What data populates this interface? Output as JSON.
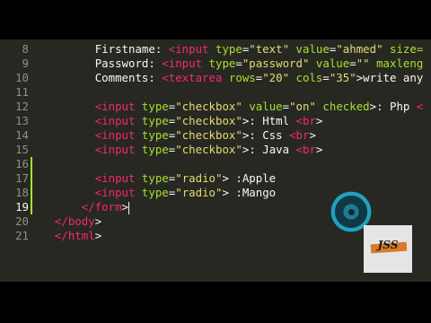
{
  "editor": {
    "current_line": "19",
    "lines": [
      {
        "n": "8",
        "indent": "        ",
        "tokens": [
          [
            "txt",
            "Firstname: "
          ],
          [
            "tag",
            "<input"
          ],
          [
            "txt",
            " "
          ],
          [
            "attr",
            "type"
          ],
          [
            "punc",
            "="
          ],
          [
            "str",
            "\"text\""
          ],
          [
            "txt",
            " "
          ],
          [
            "attr",
            "value"
          ],
          [
            "punc",
            "="
          ],
          [
            "str",
            "\"ahmed\""
          ],
          [
            "txt",
            " "
          ],
          [
            "attr",
            "size="
          ]
        ]
      },
      {
        "n": "9",
        "indent": "        ",
        "tokens": [
          [
            "txt",
            "Password: "
          ],
          [
            "tag",
            "<input"
          ],
          [
            "txt",
            " "
          ],
          [
            "attr",
            "type"
          ],
          [
            "punc",
            "="
          ],
          [
            "str",
            "\"password\""
          ],
          [
            "txt",
            " "
          ],
          [
            "attr",
            "value"
          ],
          [
            "punc",
            "="
          ],
          [
            "str",
            "\"\""
          ],
          [
            "txt",
            " "
          ],
          [
            "attr",
            "maxleng"
          ]
        ]
      },
      {
        "n": "10",
        "indent": "        ",
        "tokens": [
          [
            "txt",
            "Comments: "
          ],
          [
            "tag",
            "<textarea"
          ],
          [
            "txt",
            " "
          ],
          [
            "attr",
            "rows"
          ],
          [
            "punc",
            "="
          ],
          [
            "str",
            "\"20\""
          ],
          [
            "txt",
            " "
          ],
          [
            "attr",
            "cols"
          ],
          [
            "punc",
            "="
          ],
          [
            "str",
            "\"35\""
          ],
          [
            "punc",
            ">"
          ],
          [
            "txt",
            "write any"
          ]
        ]
      },
      {
        "n": "11",
        "indent": "",
        "tokens": []
      },
      {
        "n": "12",
        "indent": "        ",
        "tokens": [
          [
            "tag",
            "<input"
          ],
          [
            "txt",
            " "
          ],
          [
            "attr",
            "type"
          ],
          [
            "punc",
            "="
          ],
          [
            "str",
            "\"checkbox\""
          ],
          [
            "txt",
            " "
          ],
          [
            "attr",
            "value"
          ],
          [
            "punc",
            "="
          ],
          [
            "str",
            "\"on\""
          ],
          [
            "txt",
            " "
          ],
          [
            "attr",
            "checked"
          ],
          [
            "punc",
            ">"
          ],
          [
            "txt",
            ": Php "
          ],
          [
            "tag",
            "<"
          ]
        ]
      },
      {
        "n": "13",
        "indent": "        ",
        "tokens": [
          [
            "tag",
            "<input"
          ],
          [
            "txt",
            " "
          ],
          [
            "attr",
            "type"
          ],
          [
            "punc",
            "="
          ],
          [
            "str",
            "\"checkbox\""
          ],
          [
            "punc",
            ">"
          ],
          [
            "txt",
            ": Html "
          ],
          [
            "tag",
            "<br"
          ],
          [
            "punc",
            ">"
          ]
        ]
      },
      {
        "n": "14",
        "indent": "        ",
        "tokens": [
          [
            "tag",
            "<input"
          ],
          [
            "txt",
            " "
          ],
          [
            "attr",
            "type"
          ],
          [
            "punc",
            "="
          ],
          [
            "str",
            "\"checkbox\""
          ],
          [
            "punc",
            ">"
          ],
          [
            "txt",
            ": Css "
          ],
          [
            "tag",
            "<br"
          ],
          [
            "punc",
            ">"
          ]
        ]
      },
      {
        "n": "15",
        "indent": "        ",
        "tokens": [
          [
            "tag",
            "<input"
          ],
          [
            "txt",
            " "
          ],
          [
            "attr",
            "type"
          ],
          [
            "punc",
            "="
          ],
          [
            "str",
            "\"checkbox\""
          ],
          [
            "punc",
            ">"
          ],
          [
            "txt",
            ": Java "
          ],
          [
            "tag",
            "<br"
          ],
          [
            "punc",
            ">"
          ]
        ]
      },
      {
        "n": "16",
        "indent": "",
        "tokens": []
      },
      {
        "n": "17",
        "indent": "        ",
        "tokens": [
          [
            "tag",
            "<input"
          ],
          [
            "txt",
            " "
          ],
          [
            "attr",
            "type"
          ],
          [
            "punc",
            "="
          ],
          [
            "str",
            "\"radio\""
          ],
          [
            "punc",
            ">"
          ],
          [
            "txt",
            " :Apple"
          ]
        ]
      },
      {
        "n": "18",
        "indent": "        ",
        "tokens": [
          [
            "tag",
            "<input"
          ],
          [
            "txt",
            " "
          ],
          [
            "attr",
            "type"
          ],
          [
            "punc",
            "="
          ],
          [
            "str",
            "\"radio\""
          ],
          [
            "punc",
            ">"
          ],
          [
            "txt",
            " :Mango"
          ]
        ]
      },
      {
        "n": "19",
        "indent": "      ",
        "tokens": [
          [
            "tag",
            "</form"
          ],
          [
            "punc",
            ">"
          ]
        ]
      },
      {
        "n": "20",
        "indent": "  ",
        "tokens": [
          [
            "tag",
            "</body"
          ],
          [
            "punc",
            ">"
          ]
        ]
      },
      {
        "n": "21",
        "indent": "  ",
        "tokens": [
          [
            "tag",
            "</html"
          ],
          [
            "punc",
            ">"
          ]
        ]
      }
    ],
    "changed_lines": [
      "16",
      "17",
      "18",
      "19"
    ]
  },
  "watermark": {
    "text": "JSS"
  },
  "colors": {
    "background": "#272822",
    "tag": "#f92672",
    "attribute": "#a6e22e",
    "string": "#e6db74",
    "text": "#f8f8f2",
    "line_number": "#8f908a",
    "cursor_ring": "#23a7c4"
  }
}
